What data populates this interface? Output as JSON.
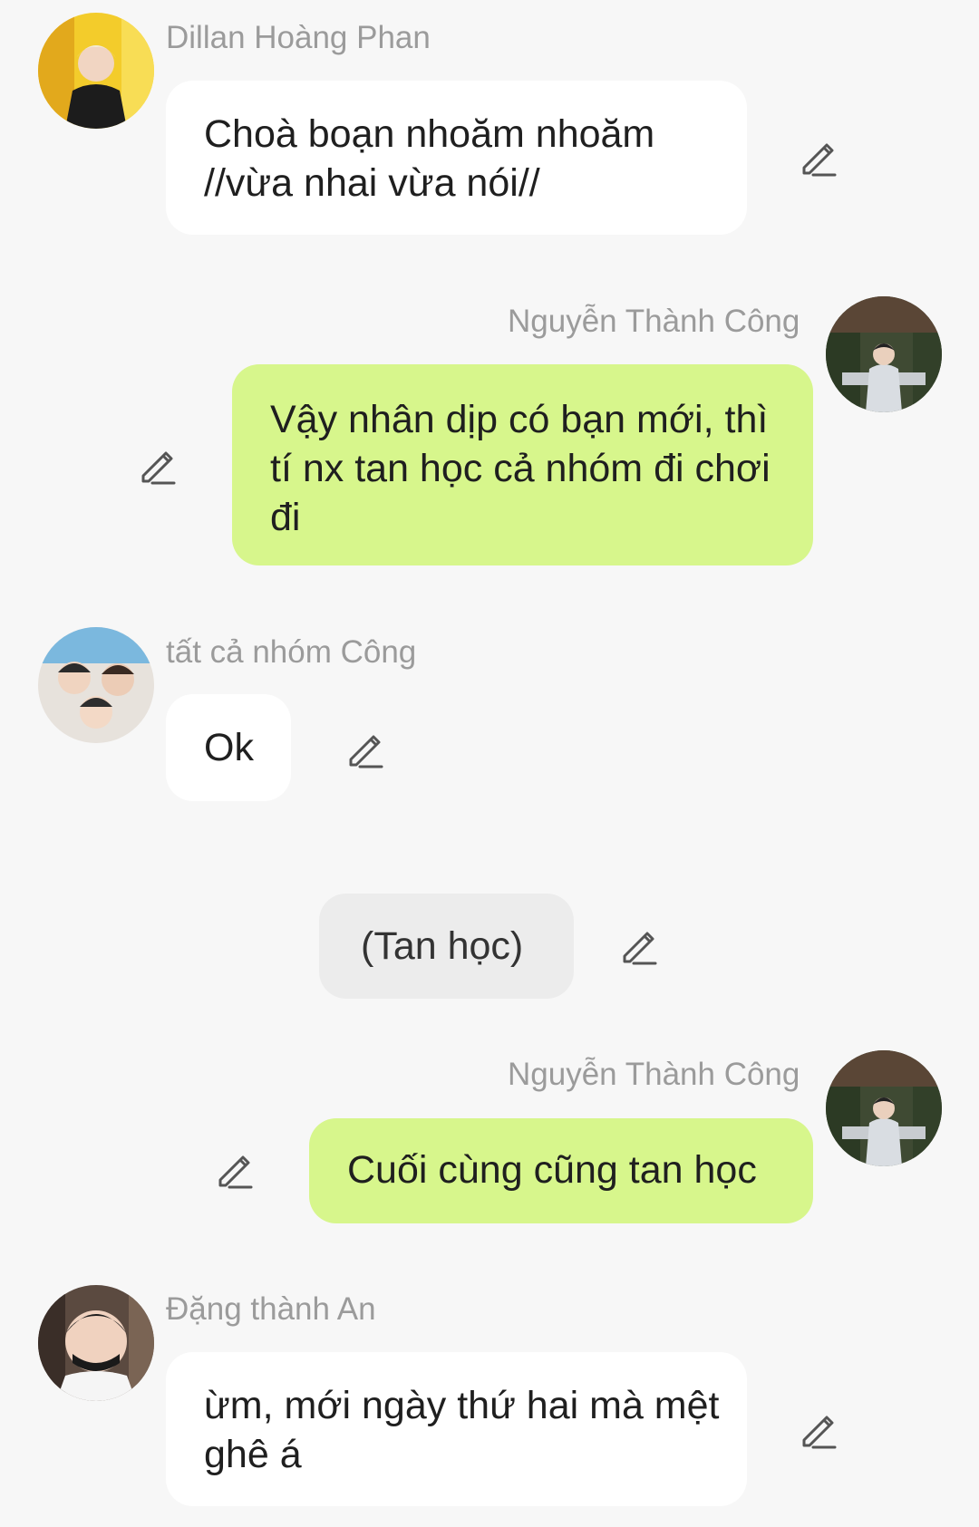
{
  "messages": [
    {
      "sender": "Dillan Hoàng Phan",
      "text": "Choà boạn nhoăm nhoăm //vừa nhai vừa nói//",
      "avatar": "avatar-blonde-boy-icon"
    },
    {
      "sender": "Nguyễn Thành Công",
      "text": "Vậy nhân dịp có bạn mới, thì tí nx tan học cả nhóm đi chơi đi",
      "avatar": "avatar-boy-outdoor-icon"
    },
    {
      "sender": "tất cả nhóm Công",
      "text": "Ok",
      "avatar": "avatar-group-icon"
    },
    {
      "text": "(Tan học)"
    },
    {
      "sender": "Nguyễn Thành Công",
      "text": "Cuối cùng cũng tan học",
      "avatar": "avatar-boy-outdoor-icon"
    },
    {
      "sender": "Đặng thành An",
      "text": "ừm, mới ngày thứ hai mà mệt ghê á",
      "avatar": "avatar-boy-mask-icon"
    }
  ],
  "colors": {
    "background": "#f7f7f7",
    "incoming_bubble": "#ffffff",
    "outgoing_bubble": "#d7f68c",
    "narration_bubble": "#ececec",
    "sender_name": "#9b9b9b"
  },
  "icons": {
    "edit": "pencil-edit-icon"
  }
}
